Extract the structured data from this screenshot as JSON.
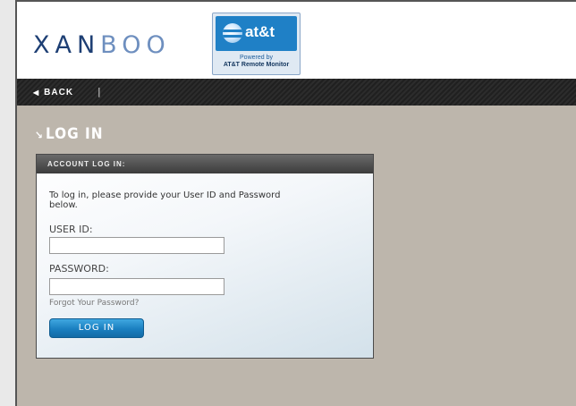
{
  "header": {
    "logo_dark": "XAN",
    "logo_light": "BOO",
    "partner_logo_text": "at&t",
    "powered_by": "Powered by",
    "powered_product": "AT&T Remote Monitor"
  },
  "nav": {
    "back_label": "BACK",
    "separator": "|"
  },
  "page": {
    "title": "LOG IN"
  },
  "login_panel": {
    "heading": "ACCOUNT LOG IN:",
    "intro": "To log in, please provide your User ID and Password below.",
    "user_id_label": "USER ID:",
    "user_id_value": "",
    "password_label": "PASSWORD:",
    "password_value": "",
    "forgot_link": "Forgot Your Password?",
    "submit_label": "LOG IN"
  },
  "colors": {
    "background": "#bdb6ac",
    "navbar": "#262626",
    "button": "#1a7fc0",
    "logo": "#1e3f74"
  }
}
